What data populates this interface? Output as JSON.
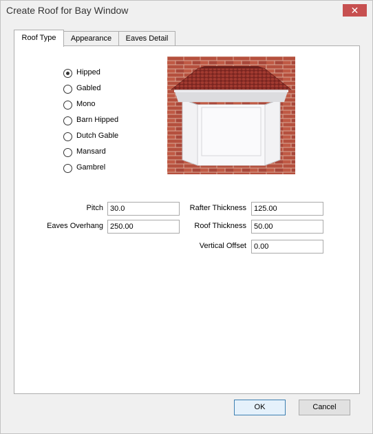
{
  "window": {
    "title": "Create Roof for Bay Window",
    "close_glyph": "✕"
  },
  "tabs": [
    {
      "label": "Roof Type",
      "active": true
    },
    {
      "label": "Appearance",
      "active": false
    },
    {
      "label": "Eaves Detail",
      "active": false
    }
  ],
  "roof_types": [
    {
      "label": "Hipped",
      "selected": true
    },
    {
      "label": "Gabled",
      "selected": false
    },
    {
      "label": "Mono",
      "selected": false
    },
    {
      "label": "Barn Hipped",
      "selected": false
    },
    {
      "label": "Dutch Gable",
      "selected": false
    },
    {
      "label": "Mansard",
      "selected": false
    },
    {
      "label": "Gambrel",
      "selected": false
    }
  ],
  "fields": {
    "pitch": {
      "label": "Pitch",
      "value": "30.0"
    },
    "eaves_overhang": {
      "label": "Eaves Overhang",
      "value": "250.00"
    },
    "rafter_thickness": {
      "label": "Rafter Thickness",
      "value": "125.00"
    },
    "roof_thickness": {
      "label": "Roof Thickness",
      "value": "50.00"
    },
    "vertical_offset": {
      "label": "Vertical Offset",
      "value": "0.00"
    }
  },
  "buttons": {
    "ok": "OK",
    "cancel": "Cancel"
  },
  "colors": {
    "brick": "#b5503e",
    "roof_tile": "#8e2b24",
    "close_red": "#c75050"
  },
  "icons": {
    "close": "close-icon"
  }
}
